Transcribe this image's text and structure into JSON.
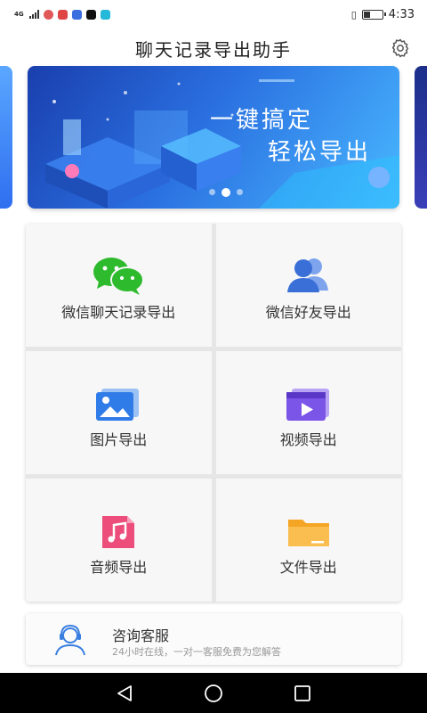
{
  "status_bar": {
    "network": "4G",
    "time": "4:33",
    "battery_level": 0.35
  },
  "header": {
    "title": "聊天记录导出助手",
    "settings_icon": "gear-icon"
  },
  "banner": {
    "line1": "一键搞定",
    "line2": "轻松导出",
    "page_count": 3,
    "active_index": 1
  },
  "features": [
    {
      "label": "微信聊天记录导出",
      "icon": "wechat-icon",
      "color": "#2dbb2d"
    },
    {
      "label": "微信好友导出",
      "icon": "contacts-icon",
      "color": "#3a6fd8"
    },
    {
      "label": "图片导出",
      "icon": "image-icon",
      "color": "#2f7be8"
    },
    {
      "label": "视频导出",
      "icon": "video-icon",
      "color": "#7b55e8"
    },
    {
      "label": "音频导出",
      "icon": "music-icon",
      "color": "#ec4d7a"
    },
    {
      "label": "文件导出",
      "icon": "folder-icon",
      "color": "#f5a524"
    }
  ],
  "support": {
    "title": "咨询客服",
    "subtitle": "24小时在线，一对一客服免费为您解答",
    "icon": "headset-agent-icon"
  },
  "nav": {
    "back_icon": "back-triangle-icon",
    "home_icon": "home-circle-icon",
    "recents_icon": "recents-square-icon"
  }
}
